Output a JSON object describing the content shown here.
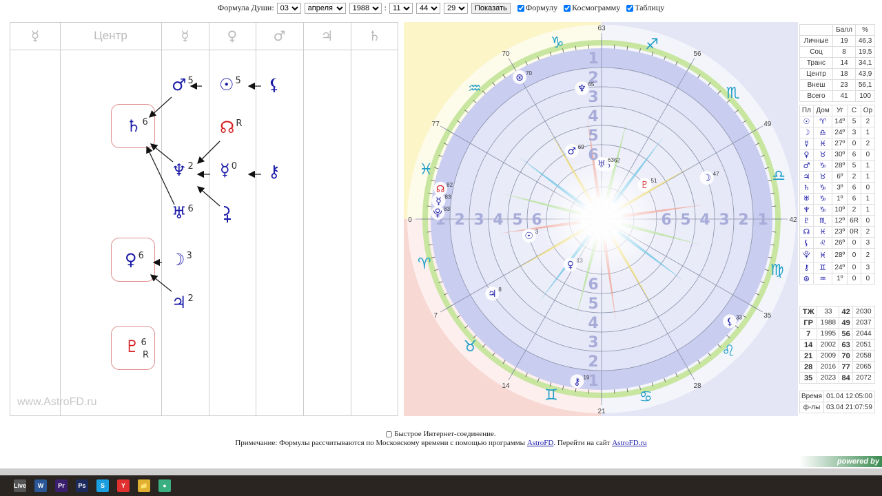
{
  "form": {
    "label": "Формула Души:",
    "day": "03",
    "month": "апреля",
    "year": "1988",
    "hour": "11",
    "minute": "44",
    "second": "29",
    "show": "Показать",
    "cb1": "Формулу",
    "cb2": "Космограмму",
    "cb3": "Таблицу"
  },
  "formula": {
    "headers": [
      "☿",
      "Центр",
      "☿",
      "♀",
      "♂",
      "♃",
      "♄"
    ],
    "watermark": "www.AstroFD.ru",
    "items": [
      {
        "g": "♂",
        "n": "5"
      },
      {
        "g": "☉",
        "n": "5"
      },
      {
        "g": "⚸",
        "n": ""
      },
      {
        "g": "♄",
        "n": "6"
      },
      {
        "g": "☊",
        "n": "R"
      },
      {
        "g": "♆",
        "n": "2"
      },
      {
        "g": "☿",
        "n": "0"
      },
      {
        "g": "⚷",
        "n": ""
      },
      {
        "g": "♅",
        "n": "6"
      },
      {
        "g": "",
        "n": ""
      },
      {
        "g": "♀",
        "n": "6"
      },
      {
        "g": "☽",
        "n": "3"
      },
      {
        "g": "♃",
        "n": "2"
      },
      {
        "g": "♇",
        "n": "6",
        "r": "R"
      }
    ]
  },
  "chart": {
    "age_labels": [
      "0",
      "7",
      "14",
      "21",
      "28",
      "35",
      "42",
      "49",
      "56",
      "63",
      "70",
      "77"
    ],
    "signs": [
      "♈",
      "♉",
      "♊",
      "♋",
      "♌",
      "♍",
      "♎",
      "♏",
      "♐",
      "♑",
      "♒",
      "♓"
    ],
    "ring_labels": [
      "1",
      "2",
      "3",
      "4",
      "5",
      "6"
    ],
    "planets": [
      {
        "g": "☉",
        "age": 3,
        "level": 5,
        "label": "3"
      },
      {
        "g": "♃",
        "age": 8,
        "level": 2,
        "label": "8"
      },
      {
        "g": "♀",
        "age": 13,
        "level": 6,
        "label": "13"
      },
      {
        "g": "⚷",
        "age": 19,
        "level": 0,
        "label": "19"
      },
      {
        "g": "⚸",
        "age": 33,
        "level": 0,
        "label": "33"
      },
      {
        "g": "☽",
        "age": 47,
        "level": 3,
        "label": "47"
      },
      {
        "g": "♇",
        "age": 51,
        "level": 6,
        "label": "51",
        "red": true
      },
      {
        "g": "♄",
        "age": 61.5,
        "level": 6,
        "label": "62"
      },
      {
        "g": "♅",
        "age": 63,
        "level": 6,
        "label": "63"
      },
      {
        "g": "♆",
        "age": 65,
        "level": 2,
        "label": "65"
      },
      {
        "g": "♂",
        "age": 68.5,
        "level": 5,
        "label": "69"
      },
      {
        "g": "⊛",
        "age": 70,
        "level": 0,
        "label": "70"
      },
      {
        "g": "☊",
        "age": 81.5,
        "level": 0,
        "label": "82",
        "red": true
      },
      {
        "g": "☿",
        "age": 82.5,
        "level": 0,
        "label": "83"
      },
      {
        "g": "⯓",
        "age": 83.5,
        "level": 0,
        "label": "83"
      }
    ],
    "colors": {
      "disc": "#c9cdf0",
      "sign": "#1e9ec8",
      "line": "#8890a8"
    }
  },
  "summary": {
    "head": [
      "",
      "Балл",
      "%"
    ],
    "rows": [
      [
        "Личные",
        "19",
        "46,3"
      ],
      [
        "Соц",
        "8",
        "19,5"
      ],
      [
        "Транс",
        "14",
        "34,1"
      ],
      [
        "Центр",
        "18",
        "43,9"
      ],
      [
        "Внеш",
        "23",
        "56,1"
      ],
      [
        "Всего",
        "41",
        "100"
      ]
    ]
  },
  "planets_table": {
    "head": [
      "Пл",
      "Дом",
      "Уг",
      "С",
      "Ор"
    ],
    "rows": [
      [
        "☉",
        "♈",
        "14º",
        "5",
        "2"
      ],
      [
        "☽",
        "♎",
        "24º",
        "3",
        "1"
      ],
      [
        "☿",
        "♓",
        "27º",
        "0",
        "2"
      ],
      [
        "♀",
        "♉",
        "30º",
        "6",
        "0"
      ],
      [
        "♂",
        "♑",
        "28º",
        "5",
        "1"
      ],
      [
        "♃",
        "♉",
        "6º",
        "2",
        "1"
      ],
      [
        "♄",
        "♑",
        "3º",
        "6",
        "0"
      ],
      [
        "♅",
        "♑",
        "1º",
        "6",
        "1"
      ],
      [
        "♆",
        "♑",
        "10º",
        "2",
        "1"
      ],
      [
        "♇",
        "♏",
        "12º",
        "6R",
        "0"
      ],
      [
        "☊",
        "♓",
        "23º",
        "0R",
        "2"
      ],
      [
        "⚸",
        "♌",
        "26º",
        "0",
        "3"
      ],
      [
        "⯓",
        "♓",
        "28º",
        "0",
        "2"
      ],
      [
        "⚷",
        "♊",
        "24º",
        "0",
        "3"
      ],
      [
        "⊛",
        "♒",
        "1º",
        "0",
        "0"
      ]
    ]
  },
  "years": {
    "rows": [
      [
        "ТЖ",
        "33",
        "42",
        "2030"
      ],
      [
        "ГР",
        "1988",
        "49",
        "2037"
      ],
      [
        "7",
        "1995",
        "56",
        "2044"
      ],
      [
        "14",
        "2002",
        "63",
        "2051"
      ],
      [
        "21",
        "2009",
        "70",
        "2058"
      ],
      [
        "28",
        "2016",
        "77",
        "2065"
      ],
      [
        "35",
        "2023",
        "84",
        "2072"
      ]
    ]
  },
  "times": {
    "rows": [
      [
        "Время",
        "01.04 12:05:00"
      ],
      [
        "ф-лы",
        "03.04 21:07:59"
      ]
    ]
  },
  "footer": {
    "fast": "Быстрое Интернет-соединение.",
    "note": "Примечание: Формулы рассчитываются по Московскому времени с помощью программы ",
    "link1": "AstroFD",
    "mid": ". Перейти на сайт ",
    "link2": "AstroFD.ru",
    "powered": "powered by"
  },
  "taskbar": [
    "Live",
    "W",
    "Pr",
    "Ps",
    "S",
    "Y",
    "📁",
    "●"
  ]
}
